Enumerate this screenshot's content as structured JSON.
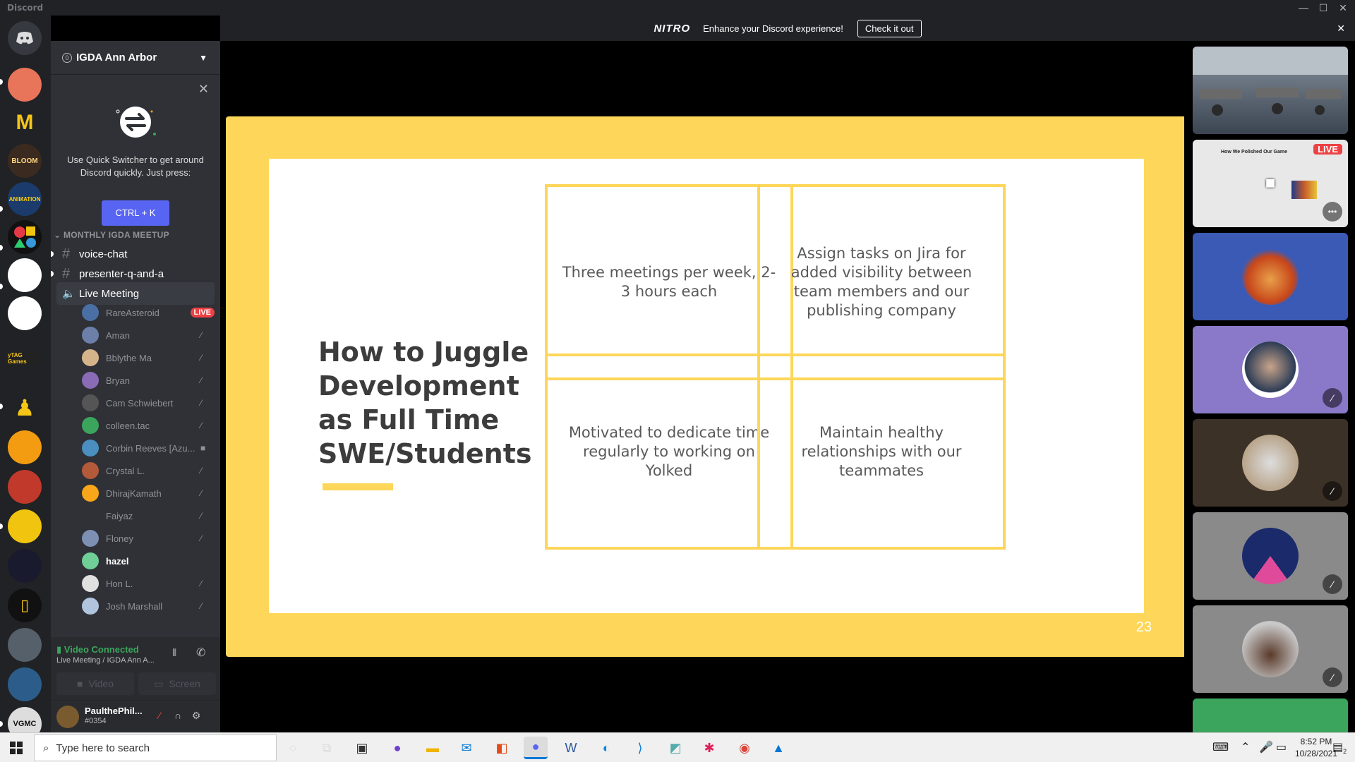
{
  "window": {
    "title": "Discord"
  },
  "nitro": {
    "logo": "NITRO",
    "message": "Enhance your Discord experience!",
    "cta": "Check it out"
  },
  "server": {
    "name": "IGDA Ann Arbor",
    "boost_level": "0"
  },
  "tip": {
    "text": "Use Quick Switcher to get around Discord quickly. Just press:",
    "shortcut": "CTRL + K"
  },
  "rail_labels": {
    "bloom": "BLOOM",
    "animation": "ANIMATION",
    "ytag": "yTAG Games",
    "vgmc": "VGMC"
  },
  "category": "MONTHLY IGDA MEETUP",
  "channels": [
    {
      "name": "voice-chat",
      "type": "text"
    },
    {
      "name": "presenter-q-and-a",
      "type": "text"
    },
    {
      "name": "Live Meeting",
      "type": "voice"
    }
  ],
  "voice_users": [
    {
      "name": "RareAsteroid",
      "live": "LIVE",
      "color": "#4a6fa5"
    },
    {
      "name": "Aman",
      "color": "#6b7fa8"
    },
    {
      "name": "Bblythe Ma",
      "color": "#d6b48a"
    },
    {
      "name": "Bryan",
      "color": "#8a6bb5"
    },
    {
      "name": "Cam Schwiebert",
      "color": "#555555"
    },
    {
      "name": "colleen.tac",
      "color": "#3ba55d"
    },
    {
      "name": "Corbin Reeves [Azu...",
      "color": "#4a8fc0"
    },
    {
      "name": "Crystal L.",
      "color": "#b35a3a"
    },
    {
      "name": "DhirajKamath",
      "color": "#faa61a"
    },
    {
      "name": "Faiyaz",
      "color": "#2f3136"
    },
    {
      "name": "Floney",
      "color": "#7d8fb3"
    },
    {
      "name": "hazel",
      "color": "#6fcf97"
    },
    {
      "name": "Hon L.",
      "color": "#e0e0e0"
    },
    {
      "name": "Josh Marshall",
      "color": "#b0c4de"
    }
  ],
  "voice_connection": {
    "status": "Video Connected",
    "location": "Live Meeting / IGDA Ann A...",
    "video_label": "Video",
    "screen_label": "Screen"
  },
  "user": {
    "name": "PaulthePhil...",
    "tag": "#0354"
  },
  "slide": {
    "title": "How to Juggle Development as Full Time SWE/Students",
    "cards": [
      "Three meetings per week, 2-3 hours each",
      "Assign tasks on Jira for added visibility between team members and our publishing company",
      "Motivated to dedicate time regularly to working on Yolked",
      "Maintain healthy relationships with our teammates"
    ],
    "page_number": "23"
  },
  "tiles": {
    "live_badge": "LIVE",
    "mini_slide_title": "How We Polished Our Game"
  },
  "taskbar": {
    "search_placeholder": "Type here to search",
    "time": "8:52 PM",
    "date": "10/28/2021",
    "notification_count": "2"
  }
}
